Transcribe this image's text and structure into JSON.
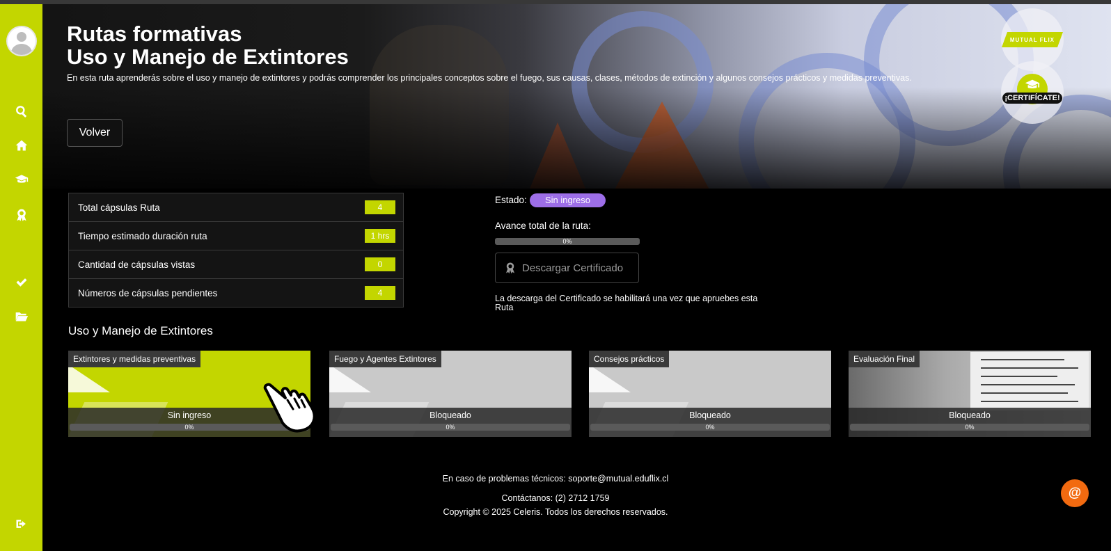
{
  "colors": {
    "accent": "#c3d600",
    "status_pill": "#9d6ee8",
    "fab": "#f26a10",
    "panel": "#141414"
  },
  "sidebar": {
    "items": [
      {
        "name": "search-icon"
      },
      {
        "name": "home-icon"
      },
      {
        "name": "graduation-cap-icon"
      },
      {
        "name": "award-icon"
      },
      {
        "name": "check-icon"
      },
      {
        "name": "folder-icon"
      },
      {
        "name": "logout-icon"
      }
    ]
  },
  "hero": {
    "title_line1": "Rutas formativas",
    "title_line2": "Uso y Manejo de Extintores",
    "description": "En esta ruta aprenderás sobre el uso y manejo de extintores y podrás comprender los principales conceptos sobre el fuego, sus causas, clases, métodos de extinción y algunos consejos prácticos y medidas preventivas.",
    "back_button": "Volver",
    "logo_text": "MUTUAL FLIX",
    "certificate_badge": "¡CERTIFÍCATE!"
  },
  "stats": [
    {
      "label": "Total cápsulas Ruta",
      "value": "4"
    },
    {
      "label": "Tiempo estimado duración ruta",
      "value": "1 hrs"
    },
    {
      "label": "Cantidad de cápsulas vistas",
      "value": "0"
    },
    {
      "label": "Números de cápsulas pendientes",
      "value": "4"
    }
  ],
  "status": {
    "estado_label": "Estado:",
    "estado_value": "Sin ingreso",
    "avance_label": "Avance total de la ruta:",
    "avance_percent": "0%",
    "avance_fraction": 0,
    "download_button": "Descargar Certificado",
    "download_note": "La descarga del Certificado se habilitará una vez que apruebes esta Ruta"
  },
  "section": {
    "title": "Uso y Manejo de Extintores"
  },
  "cards": [
    {
      "tag": "Extintores y medidas preventivas",
      "status": "Sin ingreso",
      "progress": "0%"
    },
    {
      "tag": "Fuego y Agentes Extintores",
      "status": "Bloqueado",
      "progress": "0%"
    },
    {
      "tag": "Consejos prácticos",
      "status": "Bloqueado",
      "progress": "0%"
    },
    {
      "tag": "Evaluación Final",
      "status": "Bloqueado",
      "progress": "0%"
    }
  ],
  "footer": {
    "support": "En caso de problemas técnicos: soporte@mutual.eduflix.cl",
    "contact": "Contáctanos: (2) 2712 1759",
    "copyright": "Copyright © 2025 Celeris. Todos los derechos reservados."
  },
  "fab": {
    "symbol": "@"
  }
}
